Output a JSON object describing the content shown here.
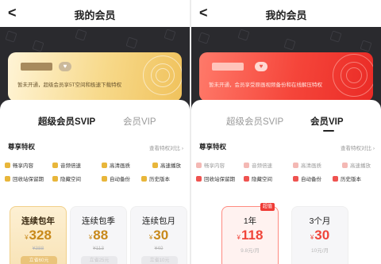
{
  "left": {
    "title": "我的会员",
    "back": "<",
    "card": {
      "badge": "♥",
      "text": "暂未开通，超级会员享5T空间和极速下载特权"
    },
    "tabs": [
      {
        "label": "超级会员SVIP",
        "active": true
      },
      {
        "label": "会员VIP",
        "active": false
      }
    ],
    "section": {
      "title": "尊享特权",
      "more": "查看特权对比 ›"
    },
    "privileges": [
      "畅享内容",
      "音频倍速",
      "高清画质",
      "高速播放",
      "回收站保留期",
      "隐藏空间",
      "自动备份",
      "历史版本"
    ],
    "plans": [
      {
        "name": "连续包年",
        "currency": "¥",
        "price": "328",
        "original": "¥388",
        "foot": "立省60元"
      },
      {
        "name": "连续包季",
        "currency": "¥",
        "price": "88",
        "original": "¥113",
        "foot": "立省25元"
      },
      {
        "name": "连续包月",
        "currency": "¥",
        "price": "30",
        "original": "¥40",
        "foot": "立省10元"
      }
    ]
  },
  "right": {
    "title": "我的会员",
    "back": "<",
    "card": {
      "badge": "♥",
      "text": "暂未开通，会员享受原画视频备份和在线解压特权"
    },
    "tabs": [
      {
        "label": "超级会员SVIP",
        "active": false
      },
      {
        "label": "会员VIP",
        "active": true
      }
    ],
    "section": {
      "title": "尊享特权",
      "more": "查看特权对比 ›"
    },
    "privileges": [
      "畅享内容",
      "音频倍速",
      "高清画质",
      "高速播放",
      "回收站保留期",
      "隐藏空间",
      "自动备份",
      "历史版本"
    ],
    "plans": [
      {
        "name": "1年",
        "currency": "¥",
        "price": "118",
        "permonth": "9.8元/月",
        "tag": "超值"
      },
      {
        "name": "3个月",
        "currency": "¥",
        "price": "30",
        "permonth": "10元/月"
      }
    ]
  },
  "colors": {
    "gold_accent": "#c8891b",
    "red_accent": "#f0453a",
    "dark_band": "#2a2a2e"
  }
}
